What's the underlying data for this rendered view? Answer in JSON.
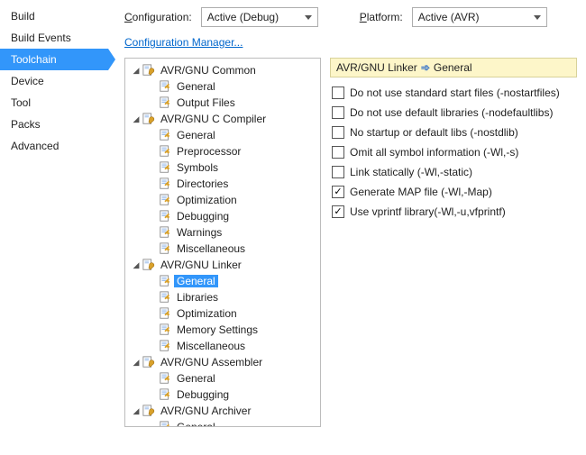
{
  "sidebar": {
    "items": [
      {
        "label": "Build"
      },
      {
        "label": "Build Events"
      },
      {
        "label": "Toolchain",
        "active": true
      },
      {
        "label": "Device"
      },
      {
        "label": "Tool"
      },
      {
        "label": "Packs"
      },
      {
        "label": "Advanced"
      }
    ]
  },
  "toprow": {
    "config_label": "Configuration:",
    "config_value": "Active (Debug)",
    "platform_label": "Platform:",
    "platform_value": "Active (AVR)"
  },
  "config_manager_link": "Configuration Manager...",
  "tree": [
    {
      "depth": 0,
      "exp": true,
      "icon": "wrench",
      "label": "AVR/GNU Common"
    },
    {
      "depth": 1,
      "icon": "sheet",
      "label": "General"
    },
    {
      "depth": 1,
      "icon": "sheet",
      "label": "Output Files"
    },
    {
      "depth": 0,
      "exp": true,
      "icon": "wrench",
      "label": "AVR/GNU C Compiler"
    },
    {
      "depth": 1,
      "icon": "sheet",
      "label": "General"
    },
    {
      "depth": 1,
      "icon": "sheet",
      "label": "Preprocessor"
    },
    {
      "depth": 1,
      "icon": "sheet",
      "label": "Symbols"
    },
    {
      "depth": 1,
      "icon": "sheet",
      "label": "Directories"
    },
    {
      "depth": 1,
      "icon": "sheet",
      "label": "Optimization"
    },
    {
      "depth": 1,
      "icon": "sheet",
      "label": "Debugging"
    },
    {
      "depth": 1,
      "icon": "sheet",
      "label": "Warnings"
    },
    {
      "depth": 1,
      "icon": "sheet",
      "label": "Miscellaneous"
    },
    {
      "depth": 0,
      "exp": true,
      "icon": "wrench",
      "label": "AVR/GNU Linker"
    },
    {
      "depth": 1,
      "icon": "sheet",
      "label": "General",
      "selected": true
    },
    {
      "depth": 1,
      "icon": "sheet",
      "label": "Libraries"
    },
    {
      "depth": 1,
      "icon": "sheet",
      "label": "Optimization"
    },
    {
      "depth": 1,
      "icon": "sheet",
      "label": "Memory Settings"
    },
    {
      "depth": 1,
      "icon": "sheet",
      "label": "Miscellaneous"
    },
    {
      "depth": 0,
      "exp": true,
      "icon": "wrench",
      "label": "AVR/GNU Assembler"
    },
    {
      "depth": 1,
      "icon": "sheet",
      "label": "General"
    },
    {
      "depth": 1,
      "icon": "sheet",
      "label": "Debugging"
    },
    {
      "depth": 0,
      "exp": true,
      "icon": "wrench",
      "label": "AVR/GNU Archiver"
    },
    {
      "depth": 1,
      "icon": "sheet",
      "label": "General"
    }
  ],
  "breadcrumb": {
    "group": "AVR/GNU Linker",
    "page": "General"
  },
  "options": [
    {
      "label": "Do not use standard start files (-nostartfiles)",
      "checked": false
    },
    {
      "label": "Do not use default libraries (-nodefaultlibs)",
      "checked": false
    },
    {
      "label": "No startup or default libs (-nostdlib)",
      "checked": false
    },
    {
      "label": "Omit all symbol information (-Wl,-s)",
      "checked": false
    },
    {
      "label": "Link statically (-Wl,-static)",
      "checked": false
    },
    {
      "label": "Generate MAP file (-Wl,-Map)",
      "checked": true
    },
    {
      "label": "Use vprintf library(-Wl,-u,vfprintf)",
      "checked": true
    }
  ]
}
